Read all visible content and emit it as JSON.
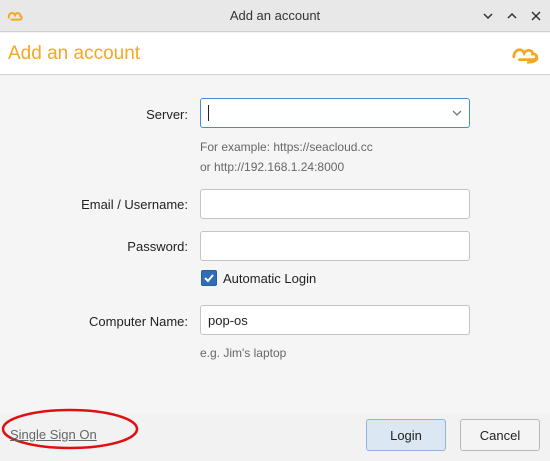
{
  "window": {
    "title": "Add an account",
    "app_icon": "seafile-logo-icon",
    "controls": [
      "chevron-down-icon",
      "chevron-up-icon",
      "close-icon"
    ]
  },
  "header": {
    "heading": "Add an account",
    "logo": "seafile-logo-icon",
    "accent_color": "#f5a623"
  },
  "form": {
    "server": {
      "label": "Server:",
      "value": ""
    },
    "server_hint_1": "For example: https://seacloud.cc",
    "server_hint_2": "or http://192.168.1.24:8000",
    "email": {
      "label": "Email / Username:",
      "value": ""
    },
    "password": {
      "label": "Password:",
      "value": ""
    },
    "auto_login": {
      "label": "Automatic Login",
      "checked": true
    },
    "computer_name": {
      "label": "Computer Name:",
      "value": "pop-os"
    },
    "computer_hint": "e.g. Jim's laptop"
  },
  "footer": {
    "sso_link": "Single Sign On",
    "login_label": "Login",
    "cancel_label": "Cancel"
  }
}
